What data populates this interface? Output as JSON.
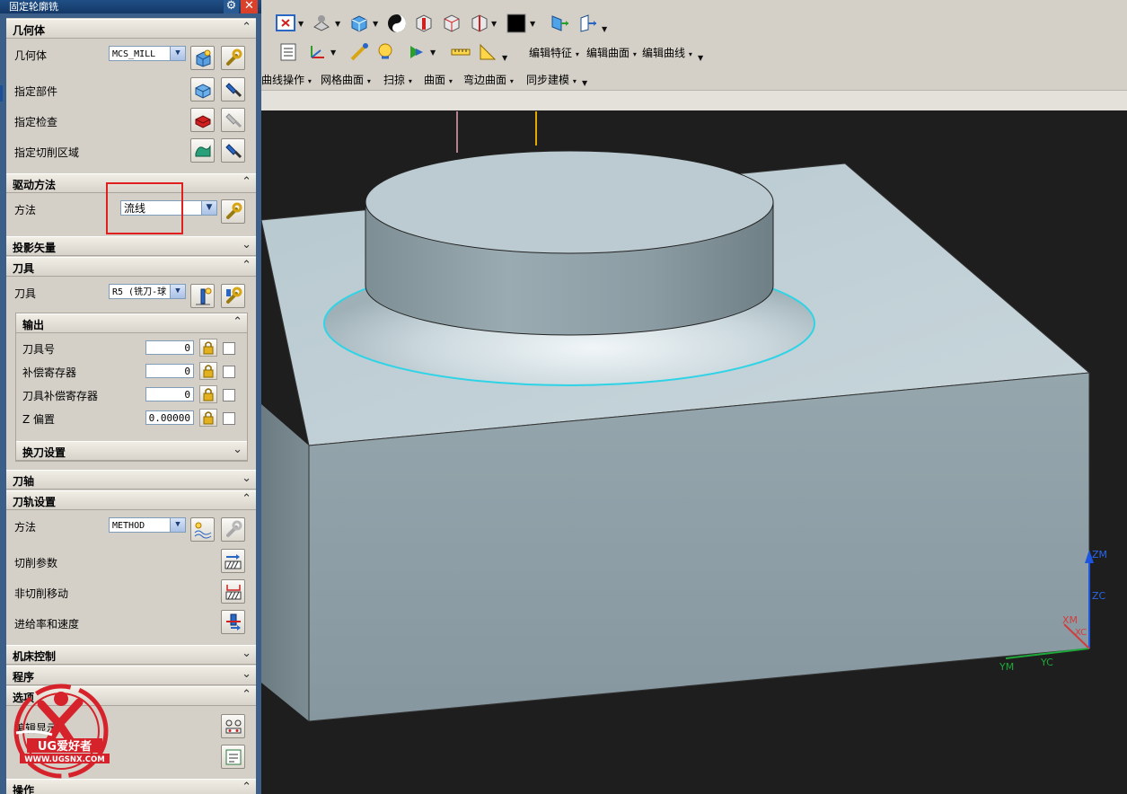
{
  "dialog": {
    "title": "固定轮廓铣",
    "gear_icon": "gear-icon",
    "close_icon": "close-icon"
  },
  "sections": {
    "geometry": "几何体",
    "drive_method": "驱动方法",
    "projection_vector": "投影矢量",
    "tool": "刀具",
    "tool_axis": "刀轴",
    "path_settings": "刀轨设置",
    "machine_control": "机床控制",
    "program": "程序",
    "options": "选项",
    "actions": "操作"
  },
  "geometry": {
    "geometry_label": "几何体",
    "geometry_value": "MCS_MILL",
    "specify_part": "指定部件",
    "specify_check": "指定检查",
    "specify_cut_area": "指定切削区域"
  },
  "drive": {
    "method_label": "方法",
    "method_value": "流线"
  },
  "tool": {
    "tool_label": "刀具",
    "tool_value": "R5 (铣刀-球",
    "output_title": "输出",
    "tool_number_label": "刀具号",
    "tool_number": "0",
    "comp_register_label": "补偿寄存器",
    "comp_register": "0",
    "tool_comp_register_label": "刀具补偿寄存器",
    "tool_comp_register": "0",
    "z_offset_label": "Z 偏置",
    "z_offset": "0.00000",
    "tool_change_title": "换刀设置"
  },
  "path": {
    "method_label": "方法",
    "method_value": "METHOD",
    "cut_params": "切削参数",
    "non_cut_moves": "非切削移动",
    "feeds_speeds": "进给率和速度"
  },
  "options": {
    "edit_display": "编辑显示"
  },
  "toolbar": {
    "edit_feature": "编辑特征",
    "edit_surface": "编辑曲面",
    "edit_curve": "编辑曲线",
    "curve_ops": "曲线操作",
    "mesh_surface": "网格曲面",
    "sweep": "扫掠",
    "surface": "曲面",
    "flange_surface": "弯边曲面",
    "sync_modeling": "同步建模"
  },
  "triad": {
    "zm": "ZM",
    "zc": "ZC",
    "xm": "XM",
    "xc": "XC",
    "ym": "YM",
    "yc": "YC"
  },
  "watermark": {
    "brand": "UG爱好者",
    "url": "WWW.UGSNX.COM"
  },
  "colors": {
    "part_top": "#c3d2d8",
    "part_side": "#8f9ea4",
    "highlight_curve": "#2fd3e6",
    "dialog_bg": "#d4d0c8",
    "callout_box": "#e0201f"
  }
}
